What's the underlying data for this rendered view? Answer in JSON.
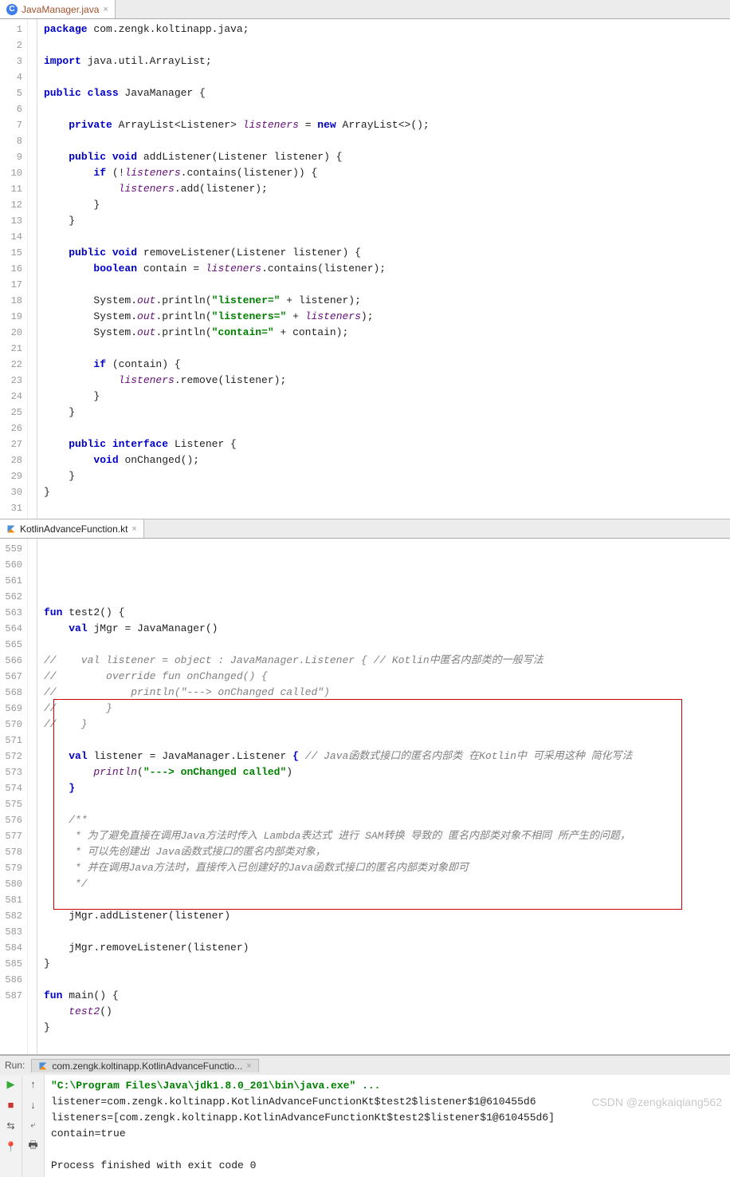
{
  "editor1": {
    "tab": {
      "label": "JavaManager.java",
      "icon": "c-letter"
    },
    "lines": {
      "start": 1,
      "end": 31,
      "code": [
        {
          "t": [
            [
              "kw",
              "package "
            ],
            [
              "",
              "com.zengk.koltinapp.java;"
            ]
          ]
        },
        {
          "t": [
            [
              "",
              ""
            ]
          ]
        },
        {
          "t": [
            [
              "kw",
              "import "
            ],
            [
              "",
              "java.util.ArrayList;"
            ]
          ]
        },
        {
          "t": [
            [
              "",
              ""
            ]
          ]
        },
        {
          "t": [
            [
              "kw",
              "public class "
            ],
            [
              "",
              "JavaManager {"
            ]
          ]
        },
        {
          "t": [
            [
              "",
              ""
            ]
          ]
        },
        {
          "t": [
            [
              "",
              "    "
            ],
            [
              "kw",
              "private "
            ],
            [
              "",
              "ArrayList<Listener> "
            ],
            [
              "fld",
              "listeners"
            ],
            [
              "",
              " = "
            ],
            [
              "kw",
              "new "
            ],
            [
              "",
              "ArrayList<>();"
            ]
          ]
        },
        {
          "t": [
            [
              "",
              ""
            ]
          ]
        },
        {
          "t": [
            [
              "",
              "    "
            ],
            [
              "kw",
              "public void "
            ],
            [
              "",
              "addListener(Listener listener) {"
            ]
          ]
        },
        {
          "t": [
            [
              "",
              "        "
            ],
            [
              "kw",
              "if "
            ],
            [
              "",
              "(!"
            ],
            [
              "fld",
              "listeners"
            ],
            [
              "",
              ".contains(listener)) {"
            ]
          ]
        },
        {
          "t": [
            [
              "",
              "            "
            ],
            [
              "fld",
              "listeners"
            ],
            [
              "",
              ".add(listener);"
            ]
          ]
        },
        {
          "t": [
            [
              "",
              "        }"
            ]
          ]
        },
        {
          "t": [
            [
              "",
              "    }"
            ]
          ]
        },
        {
          "t": [
            [
              "",
              ""
            ]
          ]
        },
        {
          "t": [
            [
              "",
              "    "
            ],
            [
              "kw",
              "public void "
            ],
            [
              "",
              "removeListener(Listener listener) {"
            ]
          ]
        },
        {
          "t": [
            [
              "",
              "        "
            ],
            [
              "kw",
              "boolean "
            ],
            [
              "",
              "contain = "
            ],
            [
              "fld",
              "listeners"
            ],
            [
              "",
              ".contains(listener);"
            ]
          ]
        },
        {
          "t": [
            [
              "",
              ""
            ]
          ]
        },
        {
          "t": [
            [
              "",
              "        System."
            ],
            [
              "fld",
              "out"
            ],
            [
              "",
              ".println("
            ],
            [
              "str",
              "\"listener=\""
            ],
            [
              "",
              " + listener);"
            ]
          ]
        },
        {
          "t": [
            [
              "",
              "        System."
            ],
            [
              "fld",
              "out"
            ],
            [
              "",
              ".println("
            ],
            [
              "str",
              "\"listeners=\""
            ],
            [
              "",
              " + "
            ],
            [
              "fld",
              "listeners"
            ],
            [
              "",
              ");"
            ]
          ]
        },
        {
          "t": [
            [
              "",
              "        System."
            ],
            [
              "fld",
              "out"
            ],
            [
              "",
              ".println("
            ],
            [
              "str",
              "\"contain=\""
            ],
            [
              "",
              " + contain);"
            ]
          ]
        },
        {
          "t": [
            [
              "",
              ""
            ]
          ]
        },
        {
          "t": [
            [
              "",
              "        "
            ],
            [
              "kw",
              "if "
            ],
            [
              "",
              "(contain) {"
            ]
          ]
        },
        {
          "t": [
            [
              "",
              "            "
            ],
            [
              "fld",
              "listeners"
            ],
            [
              "",
              ".remove(listener);"
            ]
          ]
        },
        {
          "t": [
            [
              "",
              "        }"
            ]
          ]
        },
        {
          "t": [
            [
              "",
              "    }"
            ]
          ]
        },
        {
          "t": [
            [
              "",
              ""
            ]
          ]
        },
        {
          "t": [
            [
              "",
              "    "
            ],
            [
              "kw",
              "public interface "
            ],
            [
              "",
              "Listener {"
            ]
          ]
        },
        {
          "t": [
            [
              "",
              "        "
            ],
            [
              "kw",
              "void "
            ],
            [
              "",
              "onChanged();"
            ]
          ]
        },
        {
          "t": [
            [
              "",
              "    }"
            ]
          ]
        },
        {
          "t": [
            [
              "",
              "}"
            ]
          ]
        },
        {
          "t": [
            [
              "",
              ""
            ]
          ]
        }
      ]
    }
  },
  "editor2": {
    "tab": {
      "label": "KotlinAdvanceFunction.kt",
      "icon": "kt-letter"
    },
    "lines": {
      "start": 559,
      "end": 587,
      "play_at": 584,
      "highlight": {
        "from": 569,
        "to": 581
      },
      "code": [
        {
          "n": 559,
          "t": [
            [
              "",
              ""
            ]
          ]
        },
        {
          "n": 560,
          "t": [
            [
              "kw",
              "fun "
            ],
            [
              "",
              "test2() {"
            ]
          ]
        },
        {
          "n": 561,
          "t": [
            [
              "",
              "    "
            ],
            [
              "kw",
              "val "
            ],
            [
              "",
              "jMgr = JavaManager()"
            ]
          ]
        },
        {
          "n": 562,
          "t": [
            [
              "",
              ""
            ]
          ]
        },
        {
          "n": 563,
          "t": [
            [
              "cmt",
              "//    val listener = object : JavaManager.Listener { // Kotlin中匿名内部类的一般写法"
            ]
          ]
        },
        {
          "n": 564,
          "t": [
            [
              "cmt",
              "//        override fun onChanged() {"
            ]
          ]
        },
        {
          "n": 565,
          "t": [
            [
              "cmt",
              "//            println(\"---> onChanged called\")"
            ]
          ]
        },
        {
          "n": 566,
          "t": [
            [
              "cmt",
              "//        }"
            ]
          ]
        },
        {
          "n": 567,
          "t": [
            [
              "cmt",
              "//    }"
            ]
          ]
        },
        {
          "n": 568,
          "t": [
            [
              "",
              ""
            ]
          ]
        },
        {
          "n": 569,
          "t": [
            [
              "",
              "    "
            ],
            [
              "kw",
              "val "
            ],
            [
              "",
              "listener = JavaManager.Listener "
            ],
            [
              "kw",
              "{ "
            ],
            [
              "cmt",
              "// Java函数式接口的匿名内部类 在Kotlin中 可采用这种 简化写法"
            ]
          ]
        },
        {
          "n": 570,
          "t": [
            [
              "",
              "        "
            ],
            [
              "fld",
              "println"
            ],
            [
              "",
              "("
            ],
            [
              "str",
              "\"---> onChanged called\""
            ],
            [
              "",
              ")"
            ]
          ]
        },
        {
          "n": 571,
          "t": [
            [
              "",
              "    "
            ],
            [
              "kw",
              "}"
            ]
          ]
        },
        {
          "n": 572,
          "t": [
            [
              "",
              ""
            ]
          ]
        },
        {
          "n": 573,
          "t": [
            [
              "",
              "    "
            ],
            [
              "cmt",
              "/**"
            ]
          ]
        },
        {
          "n": 574,
          "t": [
            [
              "",
              "     "
            ],
            [
              "cmt",
              "* 为了避免直接在调用Java方法时传入 Lambda表达式 进行 SAM转换 导致的 匿名内部类对象不相同 所产生的问题，"
            ]
          ]
        },
        {
          "n": 575,
          "t": [
            [
              "",
              "     "
            ],
            [
              "cmt",
              "* 可以先创建出 Java函数式接口的匿名内部类对象，"
            ]
          ]
        },
        {
          "n": 576,
          "t": [
            [
              "",
              "     "
            ],
            [
              "cmt",
              "* 并在调用Java方法时，直接传入已创建好的Java函数式接口的匿名内部类对象即可"
            ]
          ]
        },
        {
          "n": 577,
          "t": [
            [
              "",
              "     "
            ],
            [
              "cmt",
              "*/"
            ]
          ]
        },
        {
          "n": 578,
          "t": [
            [
              "",
              ""
            ]
          ]
        },
        {
          "n": 579,
          "t": [
            [
              "",
              "    jMgr.addListener(listener)"
            ]
          ]
        },
        {
          "n": 580,
          "t": [
            [
              "",
              ""
            ]
          ]
        },
        {
          "n": 581,
          "t": [
            [
              "",
              "    jMgr.removeListener(listener)"
            ]
          ]
        },
        {
          "n": 582,
          "t": [
            [
              "",
              "}"
            ]
          ]
        },
        {
          "n": 583,
          "t": [
            [
              "",
              ""
            ]
          ]
        },
        {
          "n": 584,
          "t": [
            [
              "kw",
              "fun "
            ],
            [
              "",
              "main() {"
            ]
          ]
        },
        {
          "n": 585,
          "t": [
            [
              "",
              "    "
            ],
            [
              "fld",
              "test2"
            ],
            [
              "",
              "()"
            ]
          ]
        },
        {
          "n": 586,
          "t": [
            [
              "",
              "}"
            ]
          ]
        },
        {
          "n": 587,
          "t": [
            [
              "",
              ""
            ]
          ]
        }
      ]
    }
  },
  "run": {
    "title_label": "Run:",
    "tab_label": "com.zengk.koltinapp.KotlinAdvanceFunctio...",
    "output": [
      {
        "cls": "str",
        "text": "\"C:\\Program Files\\Java\\jdk1.8.0_201\\bin\\java.exe\" ..."
      },
      {
        "cls": "",
        "text": "listener=com.zengk.koltinapp.KotlinAdvanceFunctionKt$test2$listener$1@610455d6"
      },
      {
        "cls": "",
        "text": "listeners=[com.zengk.koltinapp.KotlinAdvanceFunctionKt$test2$listener$1@610455d6]"
      },
      {
        "cls": "",
        "text": "contain=true"
      },
      {
        "cls": "",
        "text": ""
      },
      {
        "cls": "",
        "text": "Process finished with exit code 0"
      }
    ]
  },
  "watermark": "CSDN @zengkaiqiang562",
  "icons": {
    "close": "×",
    "stop": "■",
    "pin": "📌",
    "up": "↑",
    "down": "↓",
    "wrap": "↩",
    "print": "🖶",
    "steps": "≡"
  }
}
